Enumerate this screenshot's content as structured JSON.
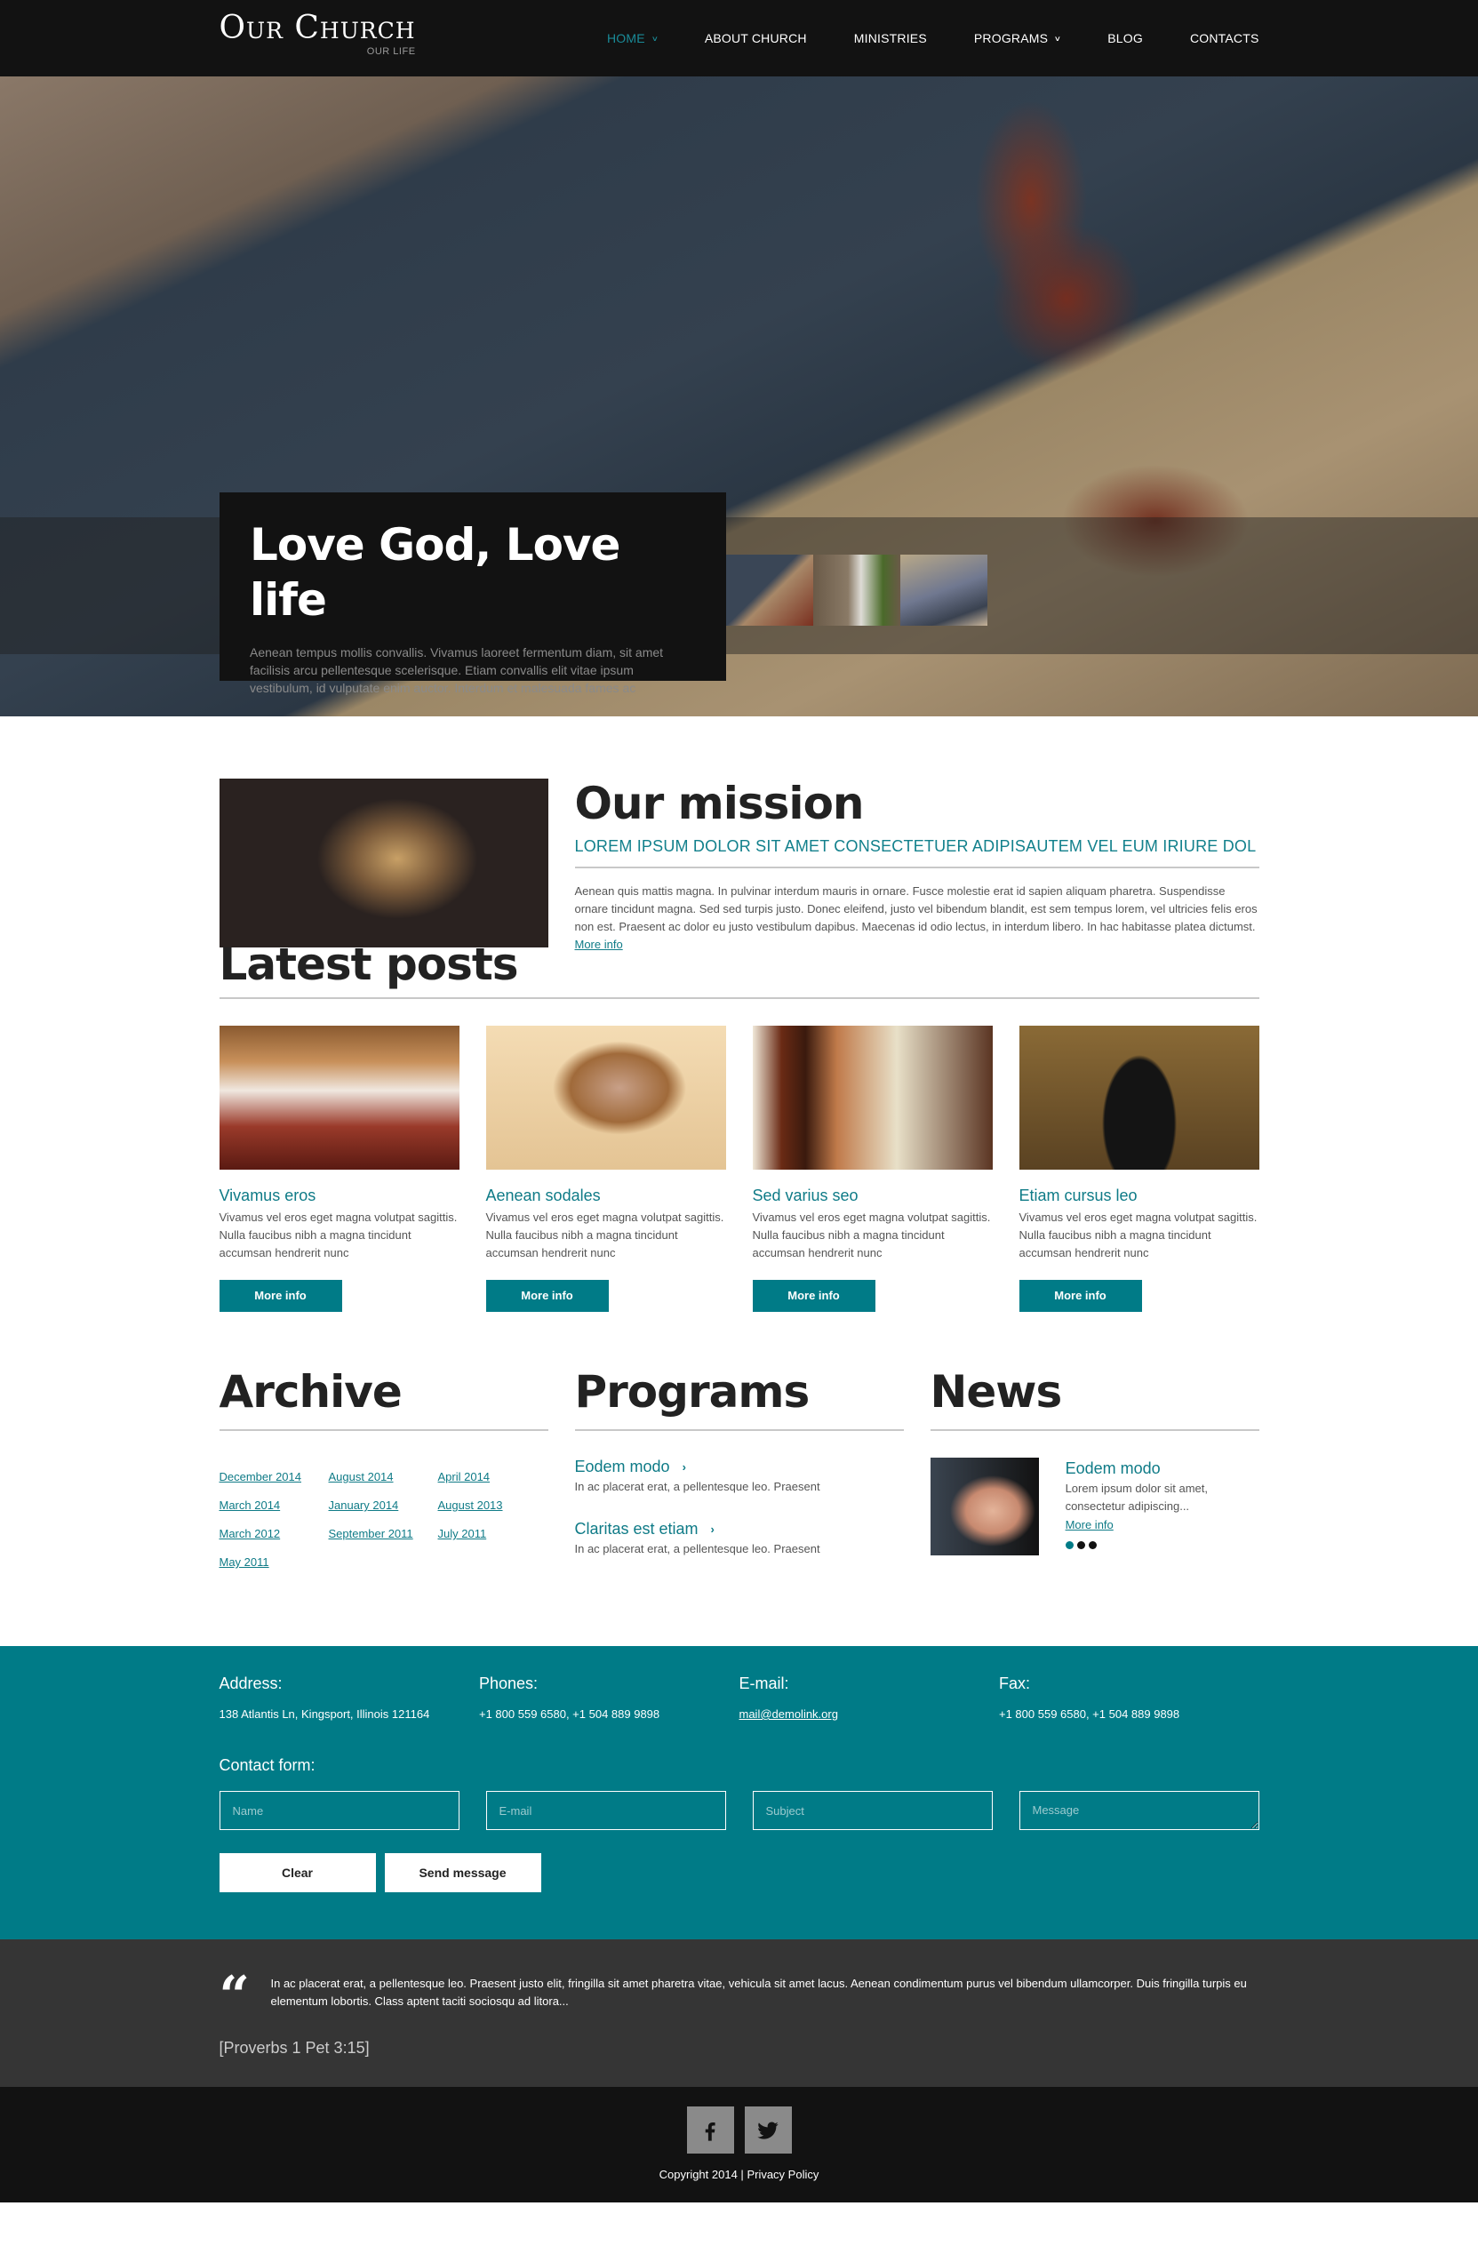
{
  "header": {
    "logo_title": "Our Church",
    "logo_tagline": "OUR LIFE",
    "nav": [
      {
        "label": "HOME",
        "active": true,
        "has_dropdown": true
      },
      {
        "label": "ABOUT CHURCH",
        "active": false,
        "has_dropdown": false
      },
      {
        "label": "MINISTRIES",
        "active": false,
        "has_dropdown": false
      },
      {
        "label": "PROGRAMS",
        "active": false,
        "has_dropdown": true
      },
      {
        "label": "BLOG",
        "active": false,
        "has_dropdown": false
      },
      {
        "label": "CONTACTS",
        "active": false,
        "has_dropdown": false
      }
    ]
  },
  "hero": {
    "title": "Love God, Love life",
    "text": "Aenean tempus mollis convallis. Vivamus laoreet fermentum diam, sit amet facilisis arcu pellentesque scelerisque. Etiam convallis elit vitae ipsum vestibulum, id vulputate enim auctor. Interdum et malesuada fames ac",
    "thumbnails": [
      "rosary-on-bible",
      "candle-and-greenery",
      "church-tower-by-sea"
    ]
  },
  "mission": {
    "title": "Our mission",
    "subtitle": "LOREM IPSUM DOLOR SIT AMET CONSECTETUER ADIPISAUTEM VEL EUM IRIURE DOL",
    "text": "Aenean quis mattis magna. In pulvinar interdum mauris in ornare. Fusce molestie erat id sapien aliquam pharetra. Suspendisse ornare tincidunt magna. Sed sed turpis justo. Donec eleifend, justo vel bibendum blandit, est sem tempus lorem, vel ultricies felis eros non est. Praesent ac dolor eu justo vestibulum dapibus. Maecenas id odio lectus, in interdum libero. In hac habitasse platea dictumst.",
    "more_label": "More info"
  },
  "posts": {
    "title": "Latest posts",
    "items": [
      {
        "title": "Vivamus eros",
        "text": "Vivamus vel eros eget magna volutpat sagittis. Nulla faucibus nibh a magna tincidunt accumsan hendrerit nunc",
        "button": "More info"
      },
      {
        "title": "Aenean sodales",
        "text": "Vivamus vel eros eget magna volutpat sagittis. Nulla faucibus nibh a magna tincidunt accumsan hendrerit nunc",
        "button": "More info"
      },
      {
        "title": "Sed varius seo",
        "text": "Vivamus vel eros eget magna volutpat sagittis. Nulla faucibus nibh a magna tincidunt accumsan hendrerit nunc",
        "button": "More info"
      },
      {
        "title": "Etiam cursus leo",
        "text": "Vivamus vel eros eget magna volutpat sagittis. Nulla faucibus nibh a magna tincidunt accumsan hendrerit nunc",
        "button": "More info"
      }
    ]
  },
  "archive": {
    "title": "Archive",
    "links": [
      "December 2014",
      "August 2014",
      "April 2014",
      "March 2014",
      "January 2014",
      "August 2013",
      "March 2012",
      "September 2011",
      "July 2011",
      "May 2011"
    ]
  },
  "programs": {
    "title": "Programs",
    "items": [
      {
        "title": "Eodem modo",
        "text": "In ac placerat erat, a pellentesque leo. Praesent"
      },
      {
        "title": "Claritas est etiam",
        "text": "In ac placerat erat, a pellentesque leo. Praesent"
      }
    ]
  },
  "news": {
    "title": "News",
    "item": {
      "title": "Eodem modo",
      "text": "Lorem ipsum dolor sit amet, consectetur adipiscing...",
      "more_label": "More info"
    },
    "slides": 3,
    "active_slide": 1
  },
  "contact": {
    "info": [
      {
        "label": "Address:",
        "value": "138 Atlantis Ln, Kingsport, Illinois 121164"
      },
      {
        "label": "Phones:",
        "value": "+1 800 559 6580, +1 504 889 9898"
      },
      {
        "label": "E-mail:",
        "value": "mail@demolink.org"
      },
      {
        "label": "Fax:",
        "value": "+1 800 559 6580, +1 504 889 9898"
      }
    ],
    "form_label": "Contact form:",
    "fields": {
      "name_placeholder": "Name",
      "email_placeholder": "E-mail",
      "subject_placeholder": "Subject",
      "message_placeholder": "Message"
    },
    "clear_label": "Clear",
    "send_label": "Send message"
  },
  "quote": {
    "icon": "quote-icon",
    "text": "In ac placerat erat, a pellentesque leo. Praesent justo elit, fringilla sit amet pharetra vitae, vehicula sit amet lacus. Aenean condimentum purus vel bibendum ullamcorper. Duis fringilla turpis eu elementum lobortis. Class aptent taciti sociosqu ad litora...",
    "reference": "[Proverbs 1 Pet 3:15]"
  },
  "footer": {
    "social": [
      "facebook-icon",
      "twitter-icon"
    ],
    "copyright": "Copyright 2014 |",
    "privacy_label": "Privacy Policy"
  },
  "colors": {
    "accent": "#007b87",
    "header_bg": "#121212",
    "quote_bg": "#353535"
  }
}
